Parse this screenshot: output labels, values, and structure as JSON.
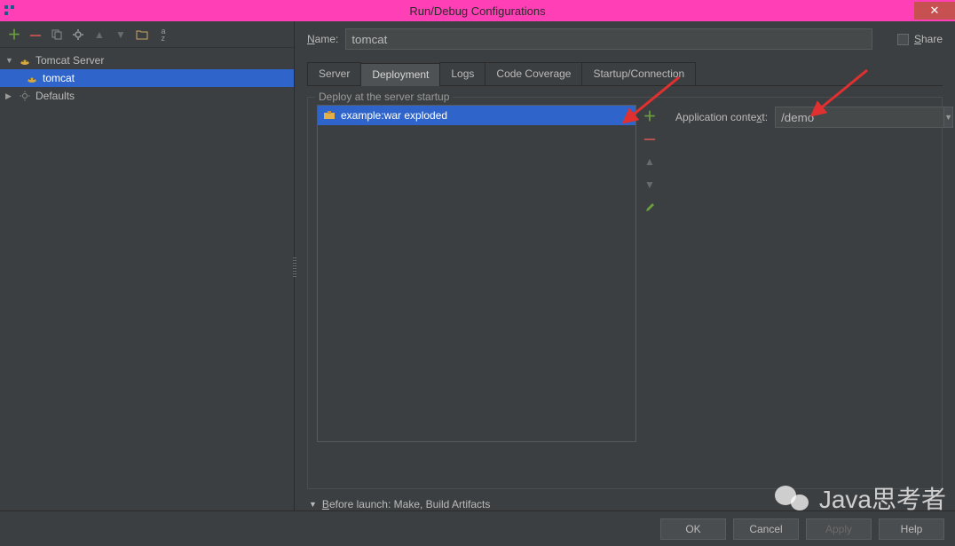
{
  "window": {
    "title": "Run/Debug Configurations"
  },
  "sidebar": {
    "items": [
      {
        "label": "Tomcat Server",
        "expanded": true,
        "icon": "tomcat"
      },
      {
        "label": "tomcat",
        "selected": true,
        "icon": "tomcat"
      },
      {
        "label": "Defaults",
        "expanded": false,
        "icon": "gear"
      }
    ]
  },
  "name_field": {
    "label": "Name:",
    "value": "tomcat"
  },
  "share": {
    "label": "Share"
  },
  "tabs": [
    {
      "label": "Server"
    },
    {
      "label": "Deployment",
      "active": true
    },
    {
      "label": "Logs"
    },
    {
      "label": "Code Coverage"
    },
    {
      "label": "Startup/Connection"
    }
  ],
  "deploy": {
    "legend": "Deploy at the server startup",
    "items": [
      {
        "label": "example:war exploded"
      }
    ],
    "app_context": {
      "label": "Application context:",
      "value": "/demo"
    }
  },
  "before_launch": {
    "label": "Before launch: Make, Build Artifacts"
  },
  "buttons": {
    "ok": "OK",
    "cancel": "Cancel",
    "apply": "Apply",
    "help": "Help"
  },
  "watermark": "Java思考者"
}
